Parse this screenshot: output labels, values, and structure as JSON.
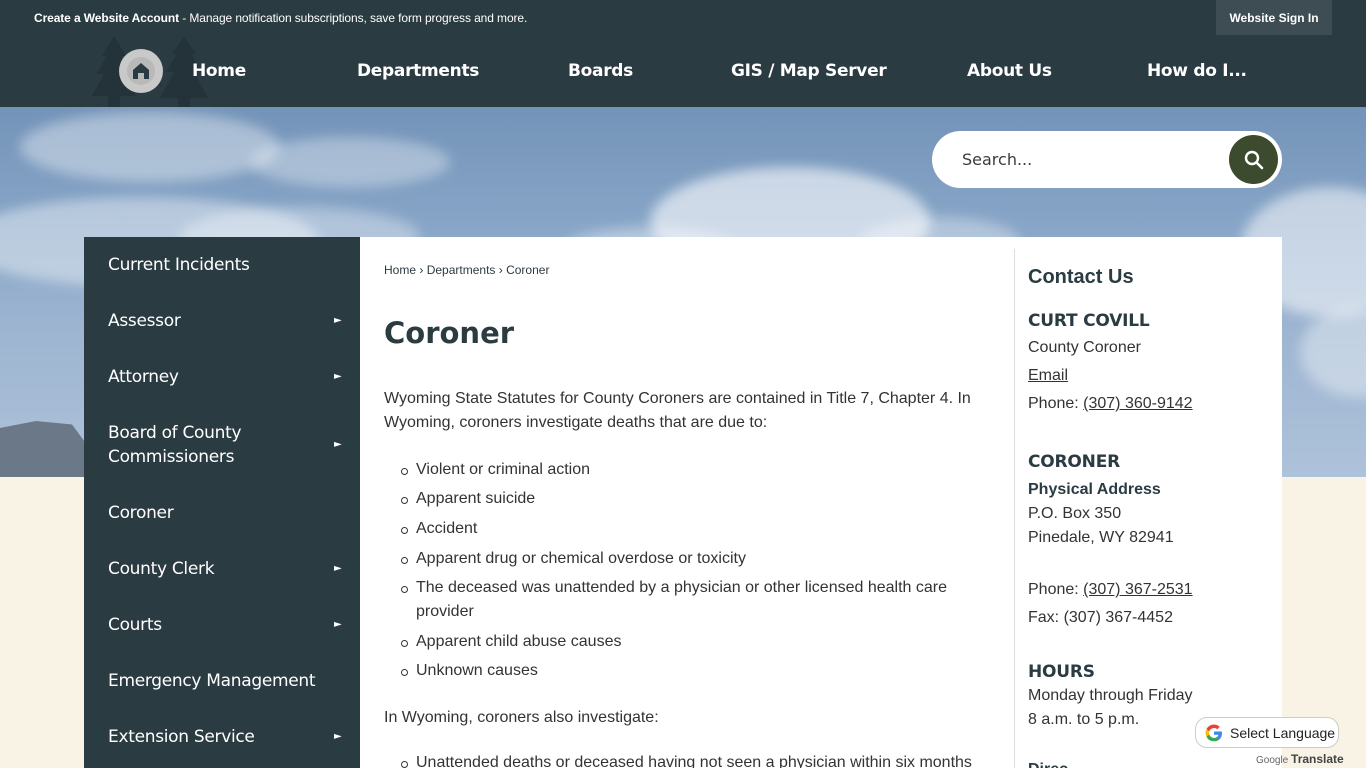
{
  "topbar": {
    "account_link": "Create a Website Account",
    "account_desc": " - Manage notification subscriptions, save form progress and more.",
    "sign_in": "Website Sign In"
  },
  "nav": {
    "items": [
      "Home",
      "Departments",
      "Boards",
      "GIS / Map Server",
      "About Us",
      "How do I..."
    ]
  },
  "search": {
    "placeholder": "Search..."
  },
  "sidebar": {
    "items": [
      {
        "label": "Current Incidents",
        "has_submenu": false
      },
      {
        "label": "Assessor",
        "has_submenu": true
      },
      {
        "label": "Attorney",
        "has_submenu": true
      },
      {
        "label": "Board of County Commissioners",
        "has_submenu": true
      },
      {
        "label": "Coroner",
        "has_submenu": false
      },
      {
        "label": "County Clerk",
        "has_submenu": true
      },
      {
        "label": "Courts",
        "has_submenu": true
      },
      {
        "label": "Emergency Management",
        "has_submenu": false
      },
      {
        "label": "Extension Service",
        "has_submenu": true
      }
    ],
    "arrow_glyph": "►"
  },
  "breadcrumb": [
    "Home",
    "Departments",
    "Coroner"
  ],
  "breadcrumb_sep": "›",
  "page": {
    "title": "Coroner",
    "intro": "Wyoming State Statutes for County Coroners are contained in Title 7, Chapter 4. In Wyoming, coroners investigate deaths that are due to:",
    "causes": [
      "Violent or criminal action",
      "Apparent suicide",
      "Accident",
      "Apparent drug or chemical overdose or toxicity",
      "The deceased was unattended by a physician or other licensed health care provider",
      "Apparent child abuse causes",
      "Unknown causes"
    ],
    "also": "In Wyoming, coroners also investigate:",
    "also_items": [
      "Unattended deaths or deceased having not seen a physician within six months"
    ]
  },
  "contact": {
    "title": "Contact Us",
    "name": "CURT COVILL",
    "role": "County Coroner",
    "email_label": "Email",
    "phone_label": "Phone: ",
    "phone": "(307) 360-9142",
    "dept": "CORONER",
    "address_label": "Physical Address",
    "address1": "P.O. Box 350",
    "address2": "Pinedale, WY 82941",
    "phone2_label": "Phone: ",
    "phone2": "(307) 367-2531",
    "fax": "Fax: (307) 367-4452",
    "hours_title": "HOURS",
    "hours1": "Monday through Friday",
    "hours2": "8 a.m. to 5 p.m.",
    "cut_off": "Direc"
  },
  "translate": {
    "select_label": "Select Language",
    "google": "Google",
    "translate": "Translate"
  },
  "colors": {
    "nav_bg": "#2b3b42",
    "page_bg": "#f9f3e6",
    "search_btn": "#3c4a2e"
  }
}
